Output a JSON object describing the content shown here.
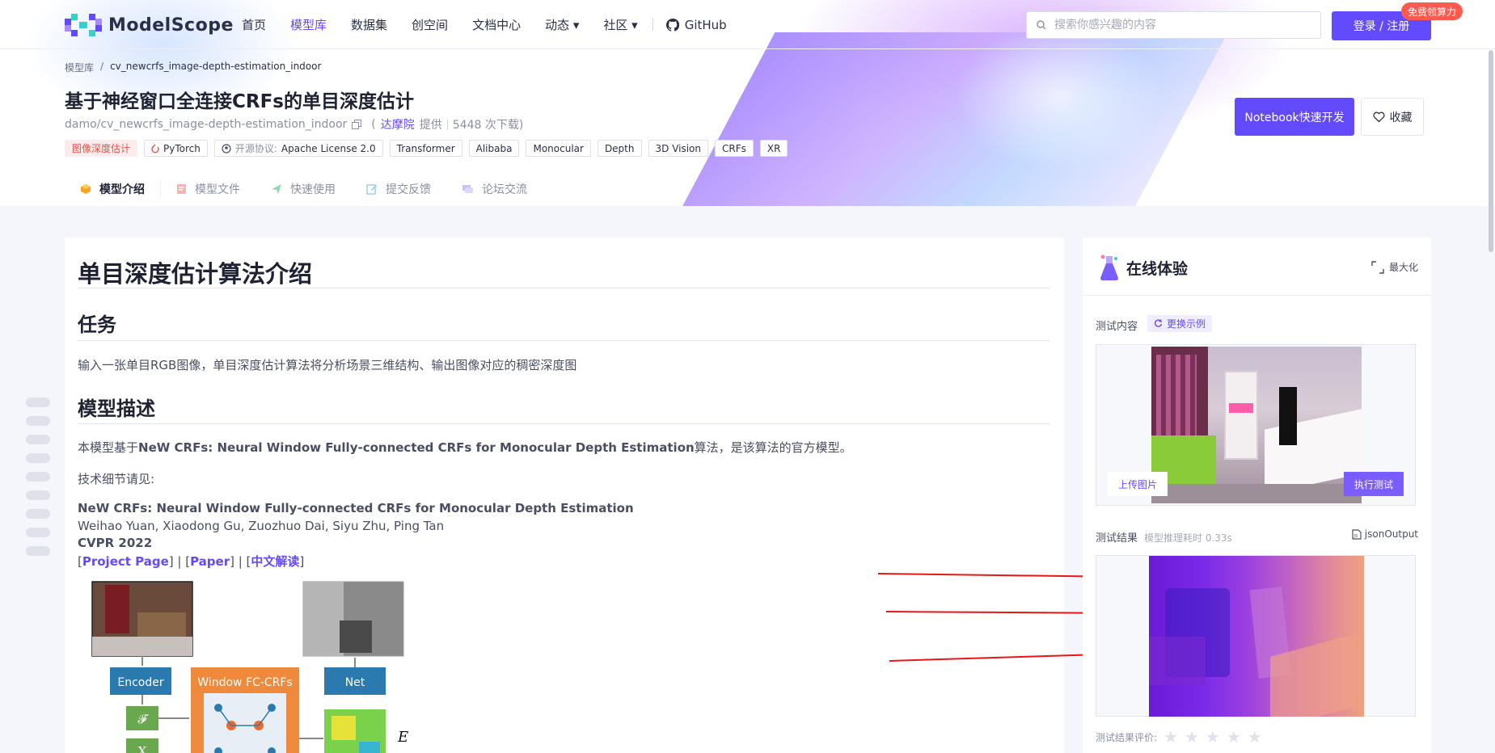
{
  "navbar": {
    "logo": "ModelScope",
    "items": [
      {
        "label": "首页",
        "active": false
      },
      {
        "label": "模型库",
        "active": true
      },
      {
        "label": "数据集",
        "active": false
      },
      {
        "label": "创空间",
        "active": false
      },
      {
        "label": "文档中心",
        "active": false
      },
      {
        "label": "动态 ▾",
        "active": false
      },
      {
        "label": "社区 ▾",
        "active": false
      }
    ],
    "github": "GitHub",
    "search_placeholder": "搜索你感兴趣的内容",
    "login": "登录 / 注册",
    "free_badge": "免费领算力"
  },
  "breadcrumb": {
    "root": "模型库",
    "sep": "/",
    "current": "cv_newcrfs_image-depth-estimation_indoor"
  },
  "header": {
    "title": "基于神经窗口全连接CRFs的单目深度估计",
    "model_id": "damo/cv_newcrfs_image-depth-estimation_indoor",
    "open_paren": "(",
    "org": "达摩院",
    "provided": "提供",
    "downloads": "5448 次下载)",
    "notebook_btn": "Notebook快速开发",
    "favorite_btn": "收藏"
  },
  "tags": {
    "task": "图像深度估计",
    "framework": "PyTorch",
    "license_label": "开源协议:",
    "license": "Apache License 2.0",
    "t1": "Transformer",
    "t2": "Alibaba",
    "t3": "Monocular",
    "t4": "Depth",
    "t5": "3D Vision",
    "t6": "CRFs",
    "t7": "XR"
  },
  "tabs": [
    "模型介绍",
    "模型文件",
    "快速使用",
    "提交反馈",
    "论坛交流"
  ],
  "content": {
    "h1": "单目深度估计算法介绍",
    "task_h": "任务",
    "task_p": "输入一张单目RGB图像，单目深度估计算法将分析场景三维结构、输出图像对应的稠密深度图",
    "desc_h": "模型描述",
    "desc_p_pre": "本模型基于",
    "desc_p_bold": "NeW CRFs: Neural Window Fully-connected CRFs for Monocular Depth Estimation",
    "desc_p_post": "算法，是该算法的官方模型。",
    "details": "技术细节请见:",
    "paper_title": "NeW CRFs: Neural Window Fully-connected CRFs for Monocular Depth Estimation",
    "authors": "Weihao Yuan, Xiaodong Gu, Zuozhuo Dai, Siyu Zhu, Ping Tan",
    "venue": "CVPR 2022",
    "links": {
      "l1": "Project Page",
      "l2": "Paper",
      "l3": "中文解读"
    },
    "diagram": {
      "encoder": "Encoder",
      "fc": "Window FC-CRFs",
      "net": "Net",
      "f": "𝓕",
      "x": "X",
      "e": "E"
    }
  },
  "panel": {
    "title": "在线体验",
    "maximize": "最大化",
    "test_content": "测试内容",
    "change_example": "更换示例",
    "upload": "上传图片",
    "run": "执行测试",
    "result": "测试结果",
    "infer_time": "模型推理耗时 0.33s",
    "json_output": "jsonOutput",
    "rating": "测试结果评价:"
  },
  "colors": {
    "accent": "#624aff",
    "badge_red": "#ff5a4d",
    "tag_red": "#e2534a",
    "arrow": "#e8161b"
  }
}
